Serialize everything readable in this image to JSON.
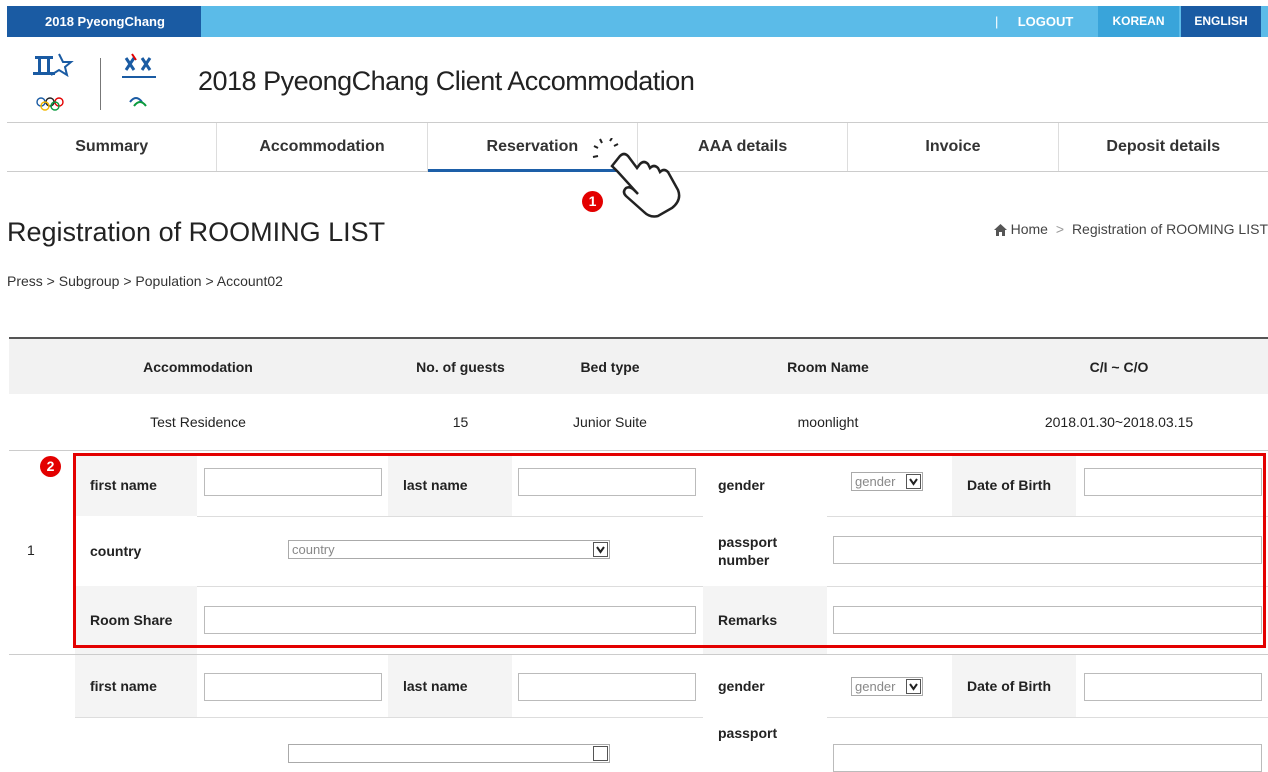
{
  "topbar": {
    "brand": "2018 PyeongChang",
    "separator": "|",
    "logout": "LOGOUT",
    "korean": "KOREAN",
    "english": "ENGLISH"
  },
  "site_title": "2018 PyeongChang Client Accommodation",
  "nav": [
    "Summary",
    "Accommodation",
    "Reservation",
    "AAA details",
    "Invoice",
    "Deposit details"
  ],
  "page": {
    "title": "Registration of ROOMING LIST",
    "breadcrumb_home": "Home",
    "breadcrumb_sep": ">",
    "breadcrumb_current": "Registration of ROOMING LIST",
    "path": "Press > Subgroup > Population > Account02"
  },
  "summary": {
    "headers": [
      "Accommodation",
      "No. of guests",
      "Bed type",
      "Room Name",
      "C/I ~ C/O"
    ],
    "row": [
      "Test Residence",
      "15",
      "Junior Suite",
      "moonlight",
      "2018.01.30~2018.03.15"
    ]
  },
  "form": {
    "first_name": "first name",
    "last_name": "last name",
    "gender": "gender",
    "gender_placeholder": "gender",
    "dob": "Date of Birth",
    "country": "country",
    "country_placeholder": "country",
    "passport_line1": "passport",
    "passport_line2": "number",
    "room_share": "Room Share",
    "remarks": "Remarks"
  },
  "entries": [
    {
      "number": "1"
    }
  ],
  "badges": {
    "step1": "1",
    "step2": "2"
  },
  "colors": {
    "accent": "#1a5ba3",
    "topbar": "#5bbbe8",
    "highlight": "#e30000"
  }
}
